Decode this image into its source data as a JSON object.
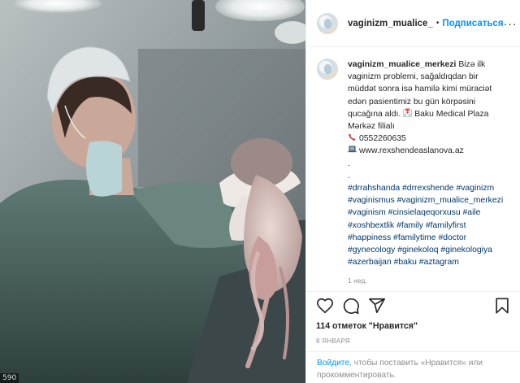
{
  "photo": {
    "badge": "590"
  },
  "header": {
    "username": "vaginizm_mualice_",
    "separator": "•",
    "follow_label": "Подписаться",
    "more_label": "···"
  },
  "caption": {
    "username": "vaginizm_mualice_merkezi",
    "lines": [
      "Bizə ilk vaginizm problemi, sağaldıqdan bir müddət sonra isə hamilə kimi müraciət edən pasientimiz bu gün körpəsini qucağına aldı.",
      "Baku Medical Plaza Mərkəz filialı",
      "0552260635",
      "www.rexshendeaslanova.az",
      ".",
      "."
    ],
    "hashtags": "#drrahshanda #drrexshende #vaginizm #vaginismus #vaginizm_mualice_merkezi #vaginism #cinsielaqeqorxusu #aile #xoshbextlik #family #familyfirst #happiness #familytime #doctor #gynecology #ginekoloq #ginekologiya #azerbaijan #baku #aztagram",
    "icons": [
      "hospital-icon",
      "phone-icon",
      "laptop-icon"
    ],
    "timestamp": "1 нед."
  },
  "actions": {
    "icons": [
      "heart-icon",
      "comment-icon",
      "share-icon",
      "bookmark-icon"
    ],
    "likes_count": "114 отметок",
    "likes_label": "\"Нравится\"",
    "date": "8 января"
  },
  "footer": {
    "login_link": "Войдите",
    "rest": ", чтобы поставить «Нравится» или прокомментировать."
  },
  "colors": {
    "accent": "#0095f6",
    "hashtag": "#00376b",
    "muted": "#8e8e8e",
    "text": "#262626"
  }
}
